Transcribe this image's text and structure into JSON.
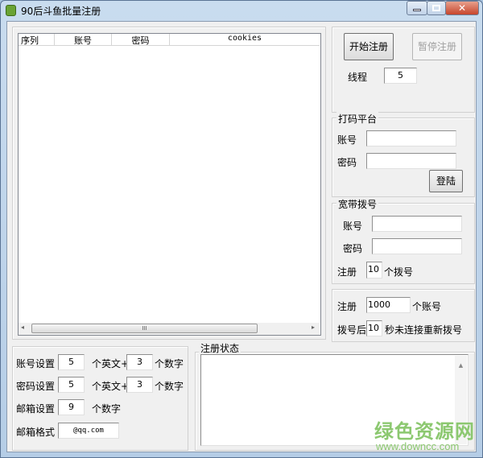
{
  "window": {
    "title": "90后斗鱼批量注册"
  },
  "list": {
    "columns": [
      "序列",
      "账号",
      "密码",
      "cookies"
    ],
    "scroll_grip": "III"
  },
  "controls": {
    "start": "开始注册",
    "pause": "暂停注册",
    "threads_label": "线程",
    "threads": "5"
  },
  "captcha": {
    "legend": "打码平台",
    "account_label": "账号",
    "password_label": "密码",
    "account": "",
    "password": "",
    "login": "登陆"
  },
  "dial": {
    "legend": "宽带拨号",
    "account_label": "账号",
    "password_label": "密码",
    "register_label": "注册",
    "count": "10",
    "count_suffix": "个拨号"
  },
  "reg": {
    "label": "注册",
    "count": "1000",
    "suffix": "个账号",
    "after_label": "拨号后",
    "seconds": "10",
    "seconds_suffix": "秒未连接重新拨号"
  },
  "settings": {
    "account_label": "账号设置",
    "account_letters": "5",
    "account_digits": "3",
    "password_label": "密码设置",
    "password_letters": "5",
    "password_digits": "3",
    "letters_suffix": "个英文+",
    "digits_suffix": "个数字",
    "email_label": "邮箱设置",
    "email_digits": "9",
    "email_format_label": "邮箱格式",
    "email_format": "@qq.com"
  },
  "status": {
    "legend": "注册状态",
    "text": ""
  },
  "watermark": {
    "name": "绿色资源网",
    "url": "www.downcc.com"
  }
}
